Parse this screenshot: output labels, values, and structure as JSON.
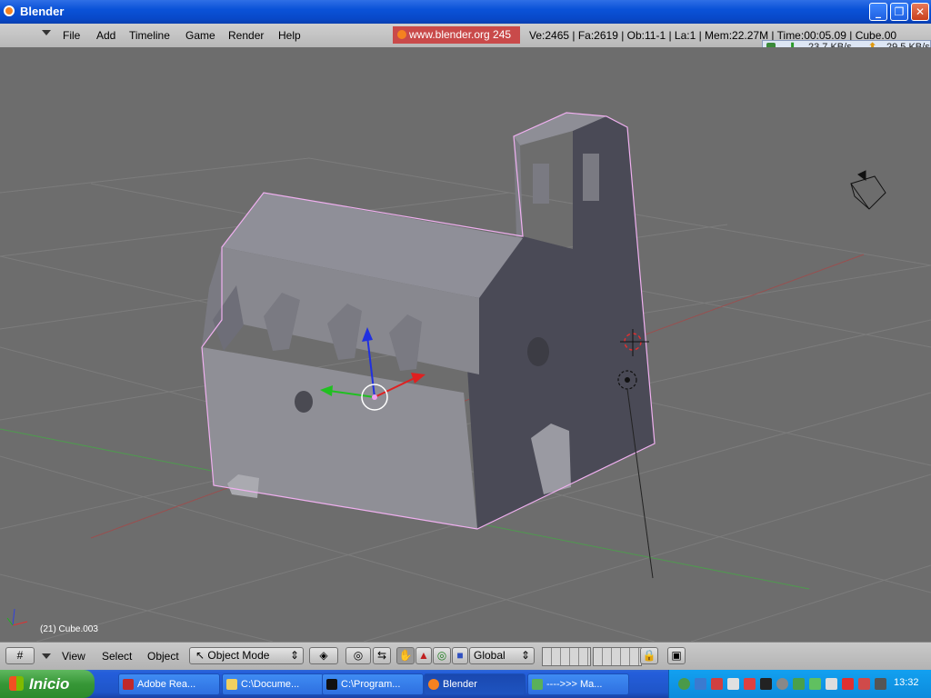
{
  "window": {
    "title": "Blender"
  },
  "menu": {
    "items": [
      "File",
      "Add",
      "Timeline",
      "Game",
      "Render",
      "Help"
    ]
  },
  "info": {
    "url": "www.blender.org 245",
    "stats": "Ve:2465 | Fa:2619 | Ob:11-1 | La:1  | Mem:22.27M  | Time:00:05.09 | Cube.00"
  },
  "net": {
    "down": "23.7 KB/s",
    "up": "29.5 KB/s"
  },
  "viewport": {
    "object_label": "(21) Cube.003"
  },
  "bottom": {
    "view": "View",
    "select": "Select",
    "object": "Object",
    "mode": "Object Mode",
    "orientation": "Global"
  },
  "taskbar": {
    "start": "Inicio",
    "tasks": [
      "Adobe Rea...",
      "C:\\Docume...",
      "C:\\Program...",
      "Blender",
      "---->>> Ma..."
    ],
    "clock": "13:32"
  },
  "colors": {
    "selection_outline": "#f0b0f0",
    "blue_axis": "#2030e0",
    "red_axis": "#e02020",
    "green_axis": "#20c020"
  }
}
